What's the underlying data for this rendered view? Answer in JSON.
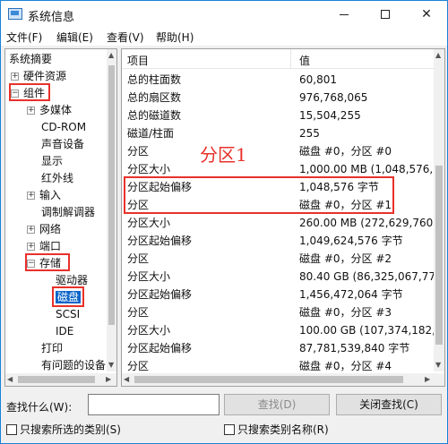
{
  "window": {
    "title": "系统信息"
  },
  "menu": [
    "文件(F)",
    "编辑(E)",
    "查看(V)",
    "帮助(H)"
  ],
  "tree": {
    "items": [
      {
        "label": "系统摘要"
      },
      {
        "label": "硬件资源",
        "expander": "+"
      },
      {
        "label": "组件",
        "expander": "−"
      },
      {
        "label": "多媒体",
        "expander": "+"
      },
      {
        "label": "CD-ROM"
      },
      {
        "label": "声音设备"
      },
      {
        "label": "显示"
      },
      {
        "label": "红外线"
      },
      {
        "label": "输入",
        "expander": "+"
      },
      {
        "label": "调制解调器"
      },
      {
        "label": "网络",
        "expander": "+"
      },
      {
        "label": "端口",
        "expander": "+"
      },
      {
        "label": "存储",
        "expander": "−"
      },
      {
        "label": "驱动器"
      },
      {
        "label": "磁盘"
      },
      {
        "label": "SCSI"
      },
      {
        "label": "IDE"
      },
      {
        "label": "打印"
      },
      {
        "label": "有问题的设备"
      }
    ]
  },
  "list": {
    "columns": [
      "项目",
      "值"
    ],
    "rows": [
      [
        "总的柱面数",
        "60,801"
      ],
      [
        "总的扇区数",
        "976,768,065"
      ],
      [
        "总的磁道数",
        "15,504,255"
      ],
      [
        "磁道/柱面",
        "255"
      ],
      [
        "分区",
        "磁盘 #0，分区 #0"
      ],
      [
        "分区大小",
        "1,000.00 MB (1,048,576,00"
      ],
      [
        "分区起始偏移",
        "1,048,576 字节"
      ],
      [
        "分区",
        "磁盘 #0，分区 #1"
      ],
      [
        "分区大小",
        "260.00 MB (272,629,760 字"
      ],
      [
        "分区起始偏移",
        "1,049,624,576 字节"
      ],
      [
        "分区",
        "磁盘 #0，分区 #2"
      ],
      [
        "分区大小",
        "80.40 GB (86,325,067,776 字"
      ],
      [
        "分区起始偏移",
        "1,456,472,064 字节"
      ],
      [
        "分区",
        "磁盘 #0，分区 #3"
      ],
      [
        "分区大小",
        "100.00 GB (107,374,182,40"
      ],
      [
        "分区起始偏移",
        "87,781,539,840 字节"
      ],
      [
        "分区",
        "磁盘 #0，分区 #4"
      ]
    ]
  },
  "annotation": "分区1",
  "find": {
    "label": "查找什么(W):",
    "value": "",
    "find_button": "查找(D)",
    "close_button": "关闭查找(C)",
    "check_selected": "只搜索所选的类别(S)",
    "check_names": "只搜索类别名称(R)"
  },
  "colors": {
    "highlight": "#0a64c8",
    "annotation_red": "#e8312b",
    "title_border": "#1883d7"
  }
}
